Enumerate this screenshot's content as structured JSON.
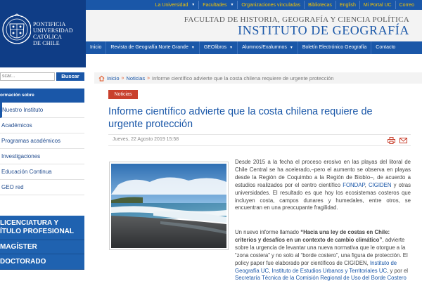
{
  "top_links": [
    "La Universidad",
    "Facultades",
    "Organizaciones vinculadas",
    "Bibliotecas",
    "English",
    "Mi Portal UC",
    "Correo"
  ],
  "university": {
    "line1": "PONTIFICIA",
    "line2": "UNIVERSIDAD",
    "line3": "CATÓLICA",
    "line4": "DE CHILE"
  },
  "header": {
    "faculty": "FACULTAD DE HISTORIA, GEOGRAFÍA Y CIENCIA POLÍTICA",
    "institute": "INSTITUTO DE GEOGRAFÍA"
  },
  "main_nav": [
    "Inicio",
    "Revista de Geografía Norte Grande",
    "GEOlibros",
    "Alumnos/Exalumnos",
    "Boletín Electrónico Geografía",
    "Contacto"
  ],
  "search": {
    "placeholder": "scar...",
    "button": "Buscar"
  },
  "sidebar": {
    "title": "ormación sobre",
    "items": [
      "Nuestro Instituto",
      "Académicos",
      "Programas académicos",
      "Investigaciones",
      "Educación Continua",
      "GEO red"
    ],
    "big_buttons": [
      {
        "line1": "LICENCIATURA Y",
        "line2": "ÍTULO PROFESIONAL"
      },
      {
        "line1": "MAGÍSTER"
      },
      {
        "line1": "DOCTORADO"
      }
    ]
  },
  "breadcrumb": {
    "home": "Inicio",
    "section": "Noticias",
    "current": "Informe científico advierte que la costa chilena requiere de urgente protección"
  },
  "article": {
    "tag": "Noticias",
    "title": "Informe científico advierte que la costa chilena requiere de urgente protección",
    "date": "Jueves, 22 Agosto 2019 15:58",
    "p1": {
      "a": "Desde 2015 a la fecha el proceso erosivo en las playas del litoral de Chile Central se ha acelerado,–pero el aumento se observa en playas desde la Región de Coquimbo a la Región de Biobío–, de acuerdo a estudios realizados por el centro científico ",
      "fondap": "FONDAP",
      "b": ", ",
      "cigiden": "CIGIDEN",
      "c": " y otras universidades. El resultado es que hoy los ecosistemas costeros que incluyen costa, campos dunares y humedales, entre otros, se encuentran en una preocupante fragilidad."
    },
    "p2": {
      "a": "Un nuevo informe llamado ",
      "bold": "“Hacia una ley de costas en Chile: criterios y desafíos en un contexto de cambio climático”",
      "b": ", advierte sobre la urgencia de levantar una nueva normativa que le otorgue a la “zona costera” y no solo al “borde costero”, una figura de protección. El policy paper fue elaborado por científicos de CIGIDEN, ",
      "link1": "Instituto de Geografía UC",
      "c": ", ",
      "link2": "Instituto de Estudios Urbanos y Territoriales UC",
      "d": ", y por el ",
      "link3": "Secretaría Técnica de la Comisión Regional de Uso del Borde Costero en Biobío",
      "e": "."
    }
  },
  "colors": {
    "primary": "#1a57a8",
    "dark_blue": "#0f3d86",
    "accent_yellow": "#f5c400",
    "tag_red": "#c9402d"
  }
}
